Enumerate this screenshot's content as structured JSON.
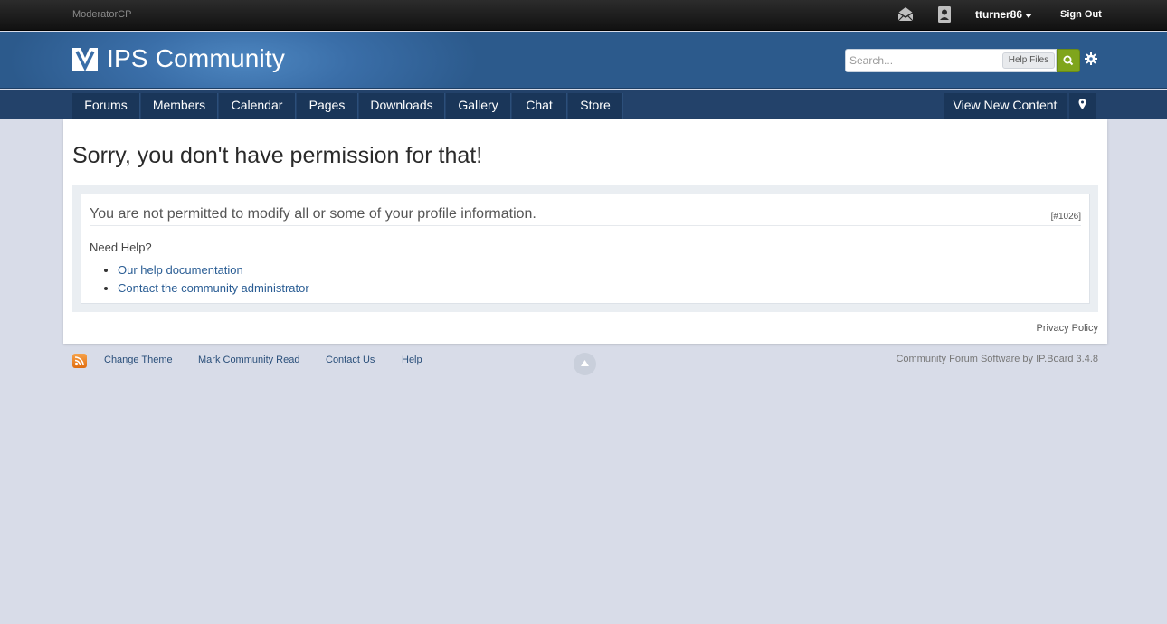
{
  "userbar": {
    "modcp_label": "ModeratorCP",
    "username": "tturner86",
    "signout_label": "Sign Out",
    "icons": [
      "envelope-icon",
      "contact-card-icon",
      "chevron-down-icon"
    ]
  },
  "branding": {
    "site_name": "IPS Community",
    "search_placeholder": "Search...",
    "search_scope": "Help Files",
    "icons": [
      "ips-logo-icon",
      "search-icon",
      "gear-icon"
    ]
  },
  "nav": {
    "tabs": [
      {
        "label": "Forums"
      },
      {
        "label": "Members"
      },
      {
        "label": "Calendar"
      },
      {
        "label": "Pages"
      },
      {
        "label": "Downloads"
      },
      {
        "label": "Gallery"
      },
      {
        "label": "Chat"
      },
      {
        "label": "Store"
      }
    ],
    "view_new_content": "View New Content",
    "icons": [
      "map-pin-icon"
    ]
  },
  "main": {
    "title": "Sorry, you don't have permission for that!",
    "error_message": "You are not permitted to modify all or some of your profile information.",
    "error_code": "[#1026]",
    "need_help_label": "Need Help?",
    "help_links": [
      "Our help documentation",
      "Contact the community administrator"
    ],
    "privacy_policy": "Privacy Policy"
  },
  "footer": {
    "links": [
      "Change Theme",
      "Mark Community Read",
      "Contact Us",
      "Help"
    ],
    "copyright": "Community Forum Software by IP.Board 3.4.8",
    "icons": [
      "rss-icon",
      "back-to-top-icon"
    ]
  },
  "colors": {
    "page_bg": "#d8dce8",
    "header_blue": "#3a6ea8",
    "nav_bg": "#23426a",
    "search_button": "#7fa51c",
    "link": "#2a5d94"
  }
}
